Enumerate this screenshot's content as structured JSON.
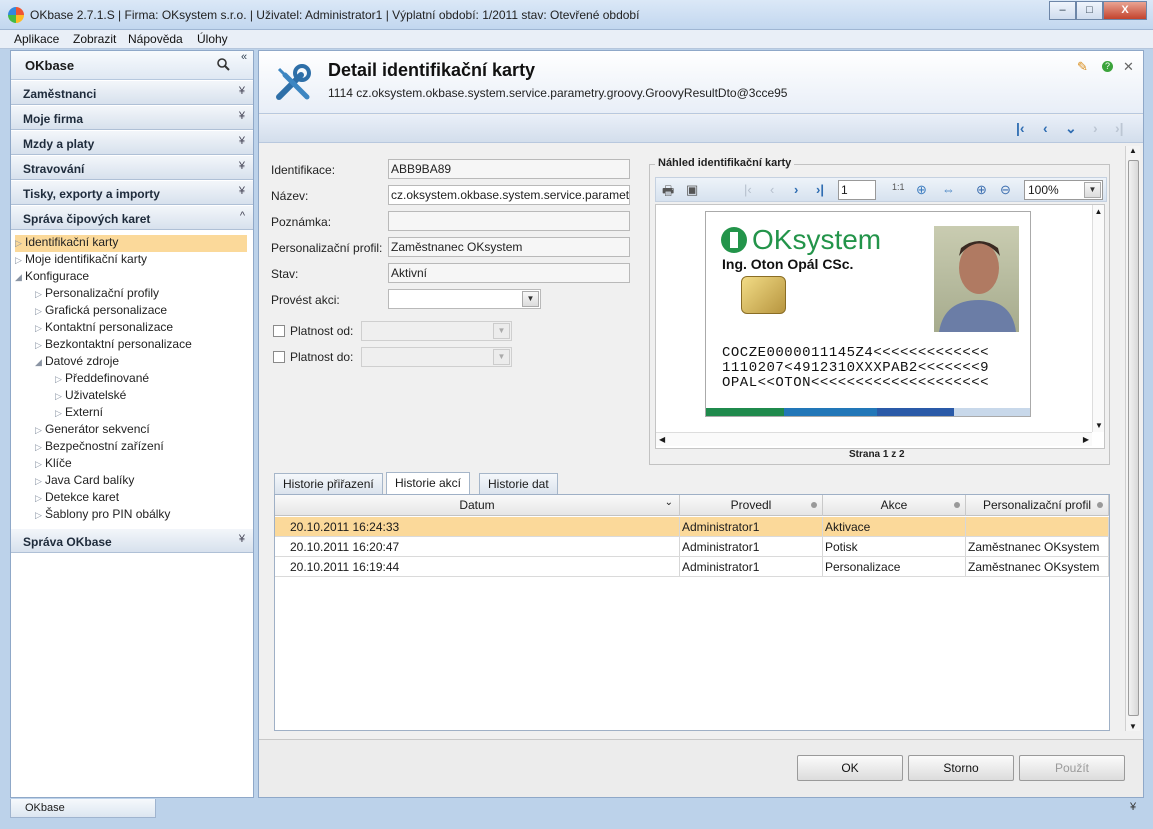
{
  "window": {
    "title": "OKbase 2.7.1.S | Firma: OKsystem s.r.o. | Uživatel: Administrator1 | Výplatní období: 1/2011 stav: Otevřené období",
    "controls": [
      "–",
      "□",
      "X"
    ]
  },
  "menu": [
    "Aplikace",
    "Zobrazit",
    "Nápověda",
    "Úlohy"
  ],
  "sidebar": {
    "title": "OKbase",
    "sections_top": [
      "Zaměstnanci",
      "Moje firma",
      "Mzdy a platy",
      "Stravování",
      "Tisky, exporty a importy"
    ],
    "open_section": "Správa čipových karet",
    "tree": [
      {
        "label": "Identifikační karty",
        "level": 0,
        "arrow": "▷",
        "selected": true
      },
      {
        "label": "Moje identifikační karty",
        "level": 0,
        "arrow": "▷"
      },
      {
        "label": "Konfigurace",
        "level": 0,
        "arrow": "◢"
      },
      {
        "label": "Personalizační profily",
        "level": 1,
        "arrow": "▷"
      },
      {
        "label": "Grafická personalizace",
        "level": 1,
        "arrow": "▷"
      },
      {
        "label": "Kontaktní personalizace",
        "level": 1,
        "arrow": "▷"
      },
      {
        "label": "Bezkontaktní personalizace",
        "level": 1,
        "arrow": "▷"
      },
      {
        "label": "Datové zdroje",
        "level": 1,
        "arrow": "◢"
      },
      {
        "label": "Předdefinované",
        "level": 2,
        "arrow": "▷"
      },
      {
        "label": "Uživatelské",
        "level": 2,
        "arrow": "▷"
      },
      {
        "label": "Externí",
        "level": 2,
        "arrow": "▷"
      },
      {
        "label": "Generátor sekvencí",
        "level": 1,
        "arrow": "▷"
      },
      {
        "label": "Bezpečnostní zařízení",
        "level": 1,
        "arrow": "▷"
      },
      {
        "label": "Klíče",
        "level": 1,
        "arrow": "▷"
      },
      {
        "label": "Java Card balíky",
        "level": 1,
        "arrow": "▷"
      },
      {
        "label": "Detekce karet",
        "level": 1,
        "arrow": "▷"
      },
      {
        "label": "Šablony pro PIN obálky",
        "level": 1,
        "arrow": "▷"
      }
    ],
    "last_section": "Správa OKbase",
    "bottom_tab": "OKbase"
  },
  "detail": {
    "title": "Detail identifikační karty",
    "subtitle": "1114 cz.oksystem.okbase.system.service.parametry.groovy.GroovyResultDto@3cce95"
  },
  "form": {
    "identifikace_label": "Identifikace:",
    "identifikace": "ABB9BA89",
    "nazev_label": "Název:",
    "nazev": "cz.oksystem.okbase.system.service.parameti",
    "poznamka_label": "Poznámka:",
    "poznamka": "",
    "profil_label": "Personalizační profil:",
    "profil": "Zaměstnanec OKsystem",
    "stav_label": "Stav:",
    "stav": "Aktivní",
    "akce_label": "Provést akci:",
    "akce": "",
    "platnost_od_label": "Platnost od:",
    "platnost_do_label": "Platnost do:"
  },
  "preview": {
    "legend": "Náhled identifikační karty",
    "page": "1",
    "zoom": "100%",
    "page_info": "Strana 1 z 2",
    "card": {
      "brand": "OKsystem",
      "name": "Ing. Oton Opál CSc.",
      "mrz": [
        "COCZE0000011145Z4<<<<<<<<<<<<<",
        "1110207<4912310XXXPAB2<<<<<<<9",
        "OPAL<<OTON<<<<<<<<<<<<<<<<<<<<"
      ],
      "stripe_colors": [
        "#1f8a4c",
        "#2277b8",
        "#2277b8",
        "#2a5aa8",
        "#c8d8ea"
      ]
    }
  },
  "tabs": [
    "Historie přiřazení",
    "Historie akcí",
    "Historie dat"
  ],
  "table": {
    "columns": [
      "Datum",
      "Provedl",
      "Akce",
      "Personalizační profil"
    ],
    "rows": [
      {
        "datum": "20.10.2011 16:24:33",
        "provedl": "Administrator1",
        "akce": "Aktivace",
        "profil": "",
        "selected": true
      },
      {
        "datum": "20.10.2011 16:20:47",
        "provedl": "Administrator1",
        "akce": "Potisk",
        "profil": "Zaměstnanec OKsystem"
      },
      {
        "datum": "20.10.2011 16:19:44",
        "provedl": "Administrator1",
        "akce": "Personalizace",
        "profil": "Zaměstnanec OKsystem"
      }
    ]
  },
  "buttons": {
    "ok": "OK",
    "storno": "Storno",
    "pouzit": "Použít"
  }
}
